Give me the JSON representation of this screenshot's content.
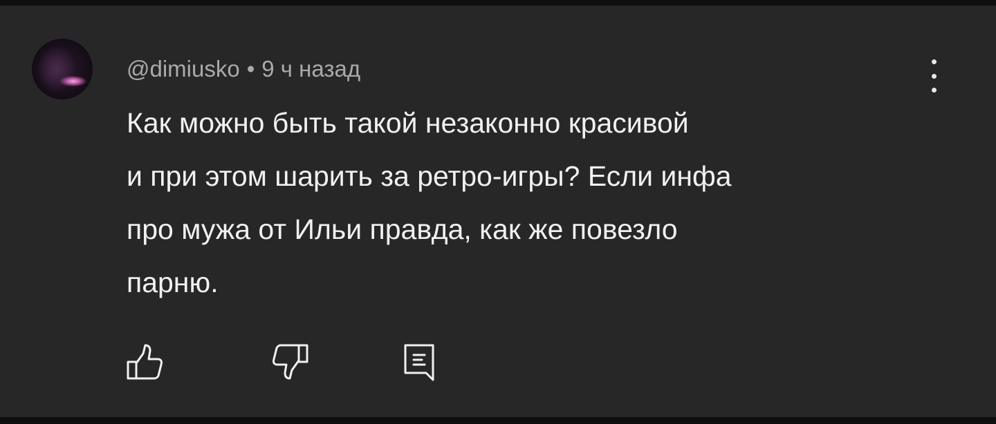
{
  "comment": {
    "author": "@dimiusko",
    "separator": "•",
    "time": "9 ч назад",
    "text_lines": [
      "Как можно быть такой незаконно красивой",
      "и при этом шарить за ретро-игры? Если инфа",
      "про мужа от Ильи правда, как же повезло",
      "парню."
    ]
  },
  "icons": {
    "avatar": "avatar",
    "menu": "more-vert-icon",
    "like": "thumb-up-icon",
    "dislike": "thumb-down-icon",
    "reply": "reply-comment-icon"
  },
  "colors": {
    "background": "#272727",
    "text": "#f1f1f1",
    "meta": "#aaaaaa",
    "icon": "#f1f1f1"
  }
}
